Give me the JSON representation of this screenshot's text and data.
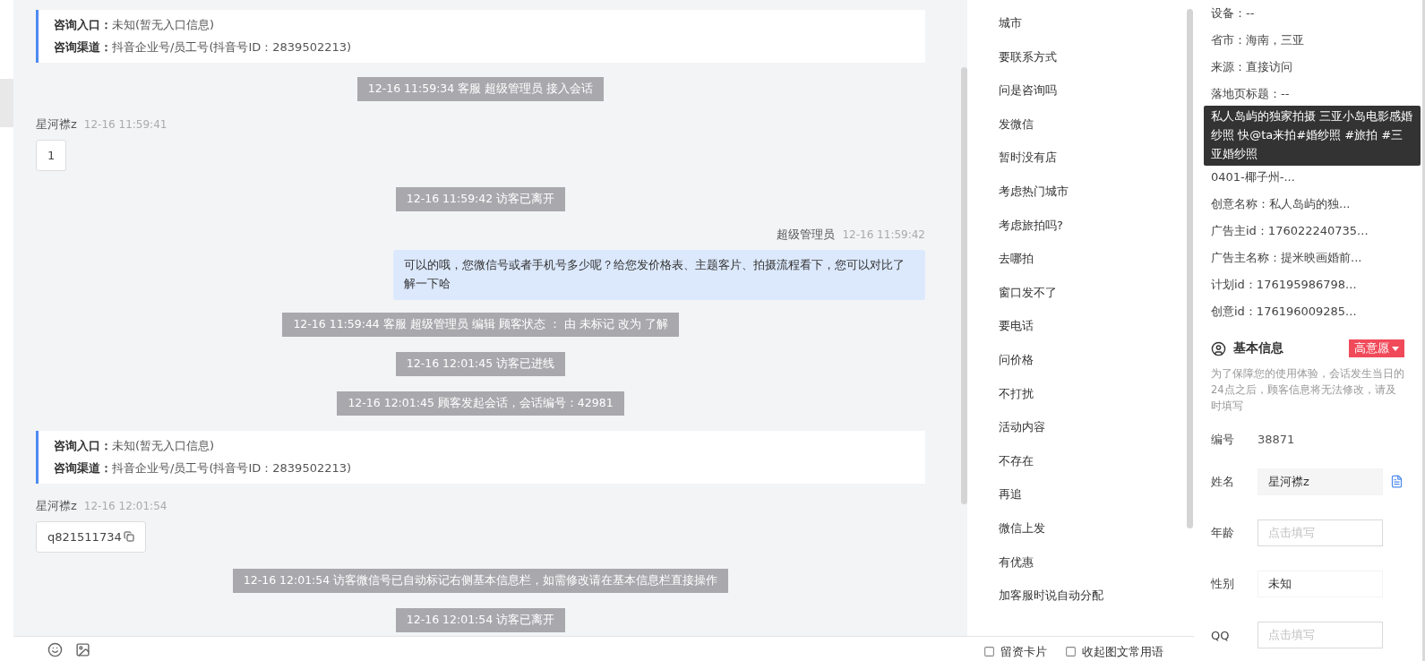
{
  "chat": {
    "messages": [
      {
        "kind": "entry",
        "lines": [
          {
            "label": "咨询入口：",
            "value": "未知(暂无入口信息)"
          },
          {
            "label": "咨询渠道：",
            "value": "抖音企业号/员工号(抖音号ID：2839502213)"
          }
        ]
      },
      {
        "kind": "system",
        "text": "12-16 11:59:34 客服 超级管理员 接入会话"
      },
      {
        "kind": "visitor",
        "name": "星河襟z",
        "time": "12-16 11:59:41",
        "text": "1",
        "copyable": false
      },
      {
        "kind": "system",
        "text": "12-16 11:59:42 访客已离开"
      },
      {
        "kind": "agent",
        "name": "超级管理员",
        "time": "12-16 11:59:42",
        "text": "可以的哦，您微信号或者手机号多少呢？给您发价格表、主题客片、拍摄流程看下，您可以对比了解一下哈"
      },
      {
        "kind": "system",
        "text": "12-16 11:59:44 客服 超级管理员 编辑 顾客状态 ： 由 未标记 改为 了解"
      },
      {
        "kind": "system",
        "text": "12-16 12:01:45 访客已进线"
      },
      {
        "kind": "system",
        "text": "12-16 12:01:45 顾客发起会话，会话编号：42981"
      },
      {
        "kind": "entry",
        "lines": [
          {
            "label": "咨询入口：",
            "value": "未知(暂无入口信息)"
          },
          {
            "label": "咨询渠道：",
            "value": "抖音企业号/员工号(抖音号ID：2839502213)"
          }
        ]
      },
      {
        "kind": "visitor",
        "name": "星河襟z",
        "time": "12-16 12:01:54",
        "text": "q821511734",
        "copyable": true
      },
      {
        "kind": "system",
        "text": "12-16 12:01:54 访客微信号已自动标记右侧基本信息栏，如需修改请在基本信息栏直接操作"
      },
      {
        "kind": "system",
        "text": "12-16 12:01:54 访客已离开"
      }
    ]
  },
  "phrases": {
    "items": [
      "城市",
      "要联系方式",
      "问是咨询吗",
      "发微信",
      "暂时没有店",
      "考虑热门城市",
      "考虑旅拍吗?",
      "去哪拍",
      "窗口发不了",
      "要电话",
      "问价格",
      "不打扰",
      "活动内容",
      "不存在",
      "再追",
      "微信上发",
      "有优惠",
      "加客服时说自动分配"
    ],
    "footer": [
      {
        "label": "留资卡片",
        "checked": false
      },
      {
        "label": "收起图文常用语",
        "checked": false
      }
    ]
  },
  "visitor_info": {
    "rows": [
      {
        "text": "设备：--"
      },
      {
        "text": "省市：海南，三亚"
      },
      {
        "text": "来源：直接访问"
      },
      {
        "text": "落地页标题：--"
      },
      {
        "text": "0401-椰子州-..."
      },
      {
        "text": "创意名称：私人岛屿的独..."
      },
      {
        "text": "广告主id：176022240735..."
      },
      {
        "text": "广告主名称：提米映画婚前..."
      },
      {
        "text": "计划id：176195986798..."
      },
      {
        "text": "创意id：176196009285..."
      }
    ],
    "tooltip": "私人岛屿的独家拍摄 三亚小岛电影感婚纱照 快@ta来拍#婚纱照 #旅拍 #三亚婚纱照"
  },
  "basic_info": {
    "title": "基本信息",
    "intent": "高意愿",
    "note": "为了保障您的使用体验，会话发生当日的24点之后，顾客信息将无法修改，请及时填写",
    "fields": [
      {
        "kind": "text",
        "label": "编号",
        "value": "38871"
      },
      {
        "kind": "filled",
        "label": "姓名",
        "value": "星河襟z"
      },
      {
        "kind": "input",
        "label": "年龄",
        "placeholder": "点击填写"
      },
      {
        "kind": "select",
        "label": "性别",
        "value": "未知"
      },
      {
        "kind": "input",
        "label": "QQ",
        "placeholder": "点击填写"
      }
    ]
  }
}
